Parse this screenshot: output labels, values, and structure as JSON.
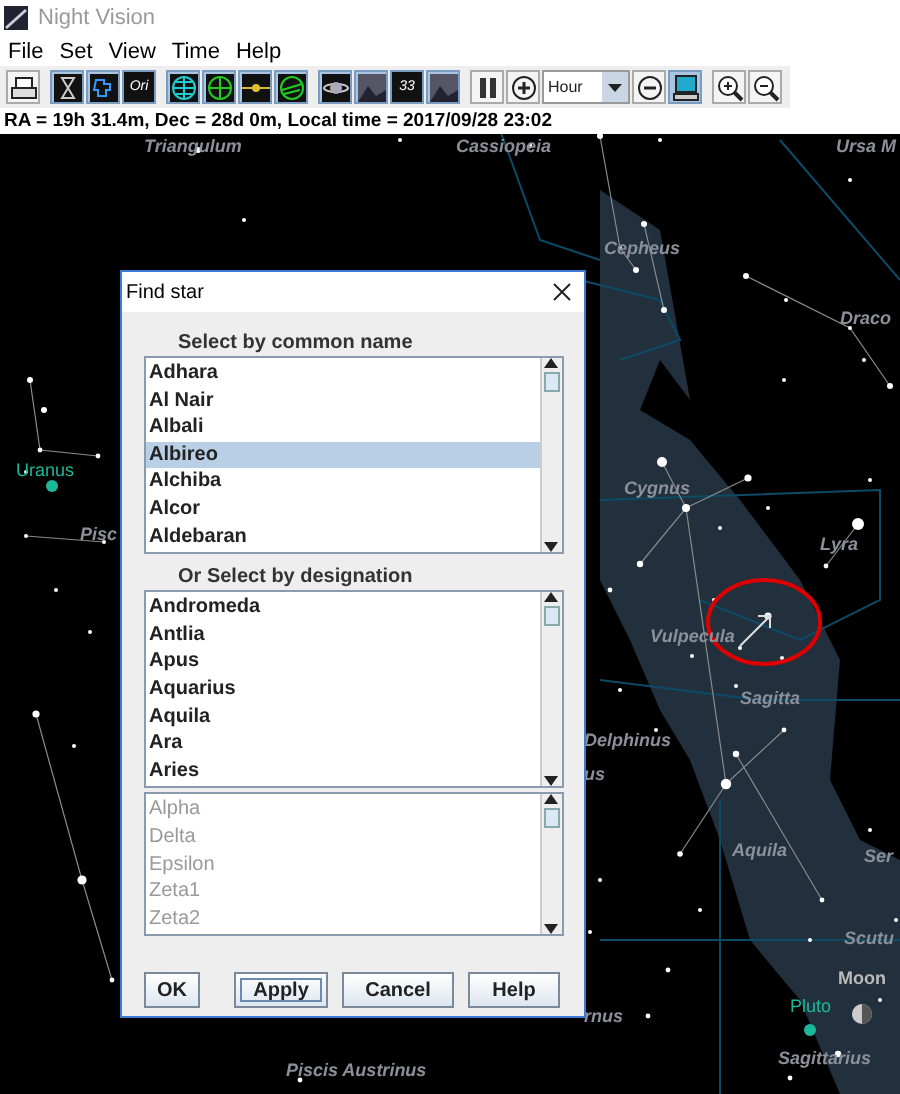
{
  "window": {
    "title": "Night Vision"
  },
  "menu": [
    "File",
    "Set",
    "View",
    "Time",
    "Help"
  ],
  "toolbar": [
    {
      "kind": "printer",
      "selected": false
    },
    {
      "kind": "hourglass",
      "selected": true
    },
    {
      "kind": "outline",
      "selected": true
    },
    {
      "kind": "text",
      "text": "Ori",
      "selected": true
    },
    {
      "kind": "grid-globe",
      "selected": true
    },
    {
      "kind": "green-globe",
      "selected": true
    },
    {
      "kind": "line",
      "selected": true
    },
    {
      "kind": "tilted-globe",
      "selected": true
    },
    {
      "kind": "planet",
      "selected": true
    },
    {
      "kind": "photo",
      "selected": true
    },
    {
      "kind": "text",
      "text": "33",
      "selected": true
    },
    {
      "kind": "photo",
      "selected": true
    },
    {
      "kind": "pause",
      "selected": false
    },
    {
      "kind": "plus",
      "selected": false
    },
    {
      "kind": "dropdown",
      "text": "Hour"
    },
    {
      "kind": "minus",
      "selected": false
    },
    {
      "kind": "monitor",
      "selected": true
    },
    {
      "kind": "zoom-in",
      "selected": false
    },
    {
      "kind": "zoom-out",
      "selected": false
    }
  ],
  "status_bar": "RA = 19h 31.4m, Dec = 28d 0m, Local time = 2017/09/28 23:02",
  "sky_labels": [
    {
      "kind": "constellation",
      "text": "Triangulum"
    },
    {
      "kind": "constellation",
      "text": "Cassiopeia"
    },
    {
      "kind": "constellation",
      "text": "Ursa M"
    },
    {
      "kind": "constellation",
      "text": "Cepheus"
    },
    {
      "kind": "constellation",
      "text": "Draco"
    },
    {
      "kind": "planet",
      "text": "Uranus"
    },
    {
      "kind": "constellation",
      "text": "Pisc"
    },
    {
      "kind": "constellation",
      "text": "Cygnus"
    },
    {
      "kind": "constellation",
      "text": "Lyra"
    },
    {
      "kind": "constellation",
      "text": "Vulpecula"
    },
    {
      "kind": "constellation",
      "text": "Sagitta"
    },
    {
      "kind": "constellation",
      "text": "Delphinus"
    },
    {
      "kind": "constellation",
      "text": "us"
    },
    {
      "kind": "constellation",
      "text": "Aquila"
    },
    {
      "kind": "constellation",
      "text": "Ser"
    },
    {
      "kind": "constellation",
      "text": "Scutu"
    },
    {
      "kind": "moon",
      "text": "Moon"
    },
    {
      "kind": "planet",
      "text": "Pluto"
    },
    {
      "kind": "constellation",
      "text": "rnus"
    },
    {
      "kind": "constellation",
      "text": "Sagittarius"
    },
    {
      "kind": "constellation",
      "text": "Piscis Austrinus"
    }
  ],
  "dialog": {
    "title": "Find star",
    "common_label": "Select by common name",
    "common_list": {
      "disabled": false,
      "items": [
        {
          "text": "Adhara",
          "selected": false
        },
        {
          "text": "Al Nair",
          "selected": false
        },
        {
          "text": "Albali",
          "selected": false
        },
        {
          "text": "Albireo",
          "selected": true
        },
        {
          "text": "Alchiba",
          "selected": false
        },
        {
          "text": "Alcor",
          "selected": false
        },
        {
          "text": "Aldebaran",
          "selected": false
        }
      ]
    },
    "designation_label": "Or Select by designation",
    "constellation_list": {
      "disabled": false,
      "items": [
        {
          "text": "Andromeda",
          "selected": false
        },
        {
          "text": "Antlia",
          "selected": false
        },
        {
          "text": "Apus",
          "selected": false
        },
        {
          "text": "Aquarius",
          "selected": false
        },
        {
          "text": "Aquila",
          "selected": false
        },
        {
          "text": "Ara",
          "selected": false
        },
        {
          "text": "Aries",
          "selected": false
        }
      ]
    },
    "designation_list": {
      "disabled": true,
      "items": [
        {
          "text": "Alpha",
          "selected": false
        },
        {
          "text": "Delta",
          "selected": false
        },
        {
          "text": "Epsilon",
          "selected": false
        },
        {
          "text": "Zeta1",
          "selected": false
        },
        {
          "text": "Zeta2",
          "selected": false
        }
      ]
    },
    "buttons": [
      {
        "label": "OK",
        "focused": false
      },
      {
        "label": "Apply",
        "focused": true
      },
      {
        "label": "Cancel",
        "focused": false
      },
      {
        "label": "Help",
        "focused": false
      }
    ]
  }
}
